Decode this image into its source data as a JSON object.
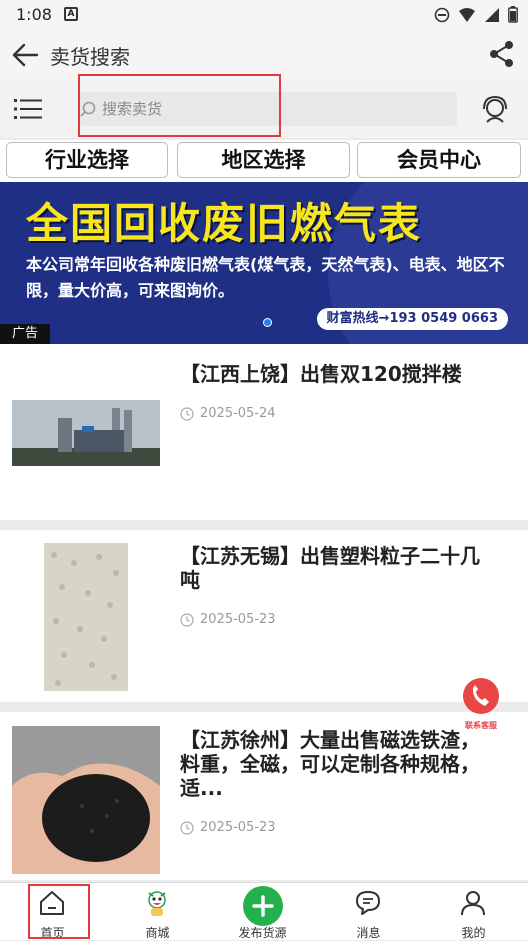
{
  "status": {
    "time": "1:08",
    "a_icon": "A"
  },
  "header": {
    "title": "卖货搜索"
  },
  "search": {
    "placeholder": "搜索卖货"
  },
  "tabs": [
    "行业选择",
    "地区选择",
    "会员中心"
  ],
  "banner": {
    "headline": "全国回收废旧燃气表",
    "body": "本公司常年回收各种废旧燃气表(煤气表，天然气表)、电表、地区不限，量大价高，可来图询价。",
    "hotline": "财富热线→193 0549 0663",
    "ad_tag": "广告"
  },
  "items": [
    {
      "title": "【江西上饶】出售双120搅拌楼",
      "date": "2025-05-24"
    },
    {
      "title": "【江苏无锡】出售塑料粒子二十几吨",
      "date": "2025-05-23"
    },
    {
      "title": "【江苏徐州】大量出售磁选铁渣，料重，全磁，可以定制各种规格，适...",
      "date": "2025-05-23"
    }
  ],
  "float_service": {
    "label": "联系客服"
  },
  "nav": [
    {
      "label": "首页",
      "icon": "home-icon"
    },
    {
      "label": "商城",
      "icon": "mascot-icon"
    },
    {
      "label": "发布货源",
      "icon": "plus-icon"
    },
    {
      "label": "消息",
      "icon": "chat-icon"
    },
    {
      "label": "我的",
      "icon": "user-icon"
    }
  ],
  "colors": {
    "accent": "#22b14c",
    "banner_bg": "#1f2f86",
    "headline": "#f6e61b",
    "highlight": "#e03b3b"
  }
}
